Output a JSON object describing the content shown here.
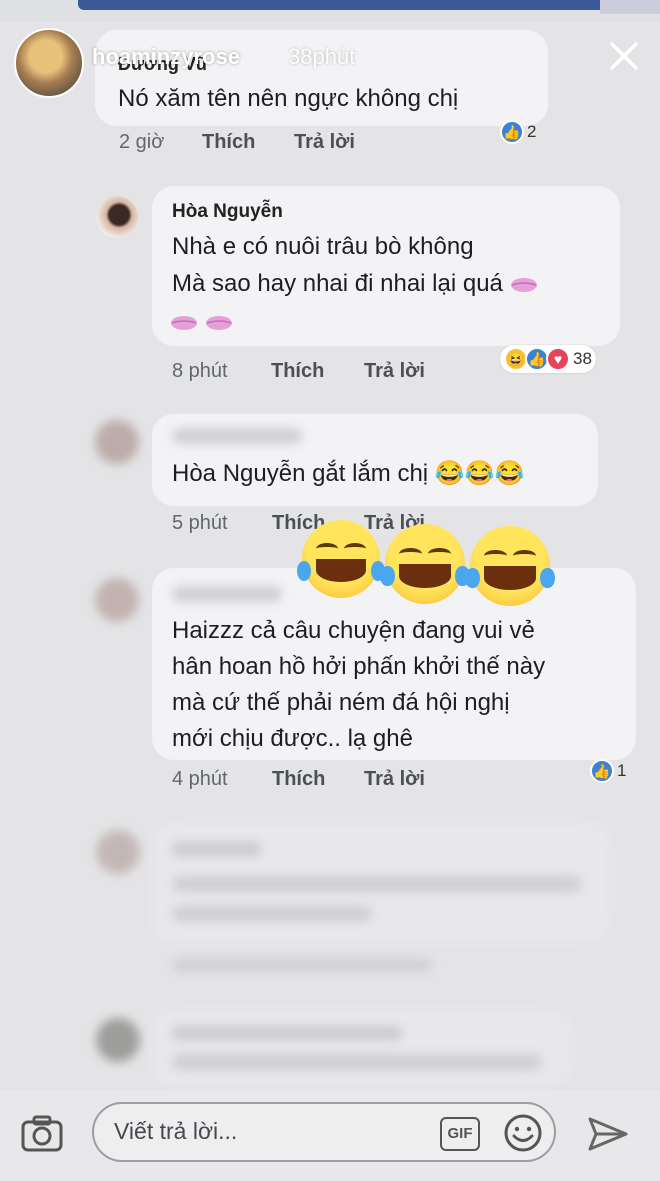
{
  "story": {
    "username": "hoaminzyrose",
    "time": "38phút"
  },
  "comments": [
    {
      "author": "Đương Vũ",
      "lines": [
        "Nó xăm tên nên ngực không chị"
      ],
      "time": "2 giờ",
      "like": "Thích",
      "reply": "Trả lời",
      "reaction_count": "2"
    },
    {
      "author": "Hòa Nguyễn",
      "lines": [
        "Nhà e có nuôi trâu bò không",
        "Mà sao hay nhai đi nhai lại quá"
      ],
      "time": "8 phút",
      "like": "Thích",
      "reply": "Trả lời",
      "reaction_count": "38"
    },
    {
      "lines": [
        "Hòa Nguyễn gắt lắm chị 😂😂😂"
      ],
      "time": "5 phút",
      "like": "Thích",
      "reply": "Trả lời"
    },
    {
      "lines": [
        "Haizzz cả câu chuyện đang vui vẻ",
        "hân hoan hồ hởi phấn khởi thế này",
        "mà cứ thế phải ném đá hội nghị",
        "mới chịu được.. lạ ghê"
      ],
      "time": "4 phút",
      "like": "Thích",
      "reply": "Trả lời",
      "reaction_count": "1"
    }
  ],
  "composer": {
    "placeholder": "Viết trả lời...",
    "gif": "GIF"
  },
  "colors": {
    "like_blue": "#3b82d6",
    "love_red": "#e8435a",
    "haha_yellow": "#f7c23a",
    "fb_blue": "#3b5998"
  },
  "icons": [
    "close-icon",
    "camera-icon",
    "gif-icon",
    "smile-icon",
    "send-icon",
    "like-icon",
    "love-icon",
    "haha-icon",
    "kiss-lips-icon",
    "tears-of-joy-emoji"
  ]
}
